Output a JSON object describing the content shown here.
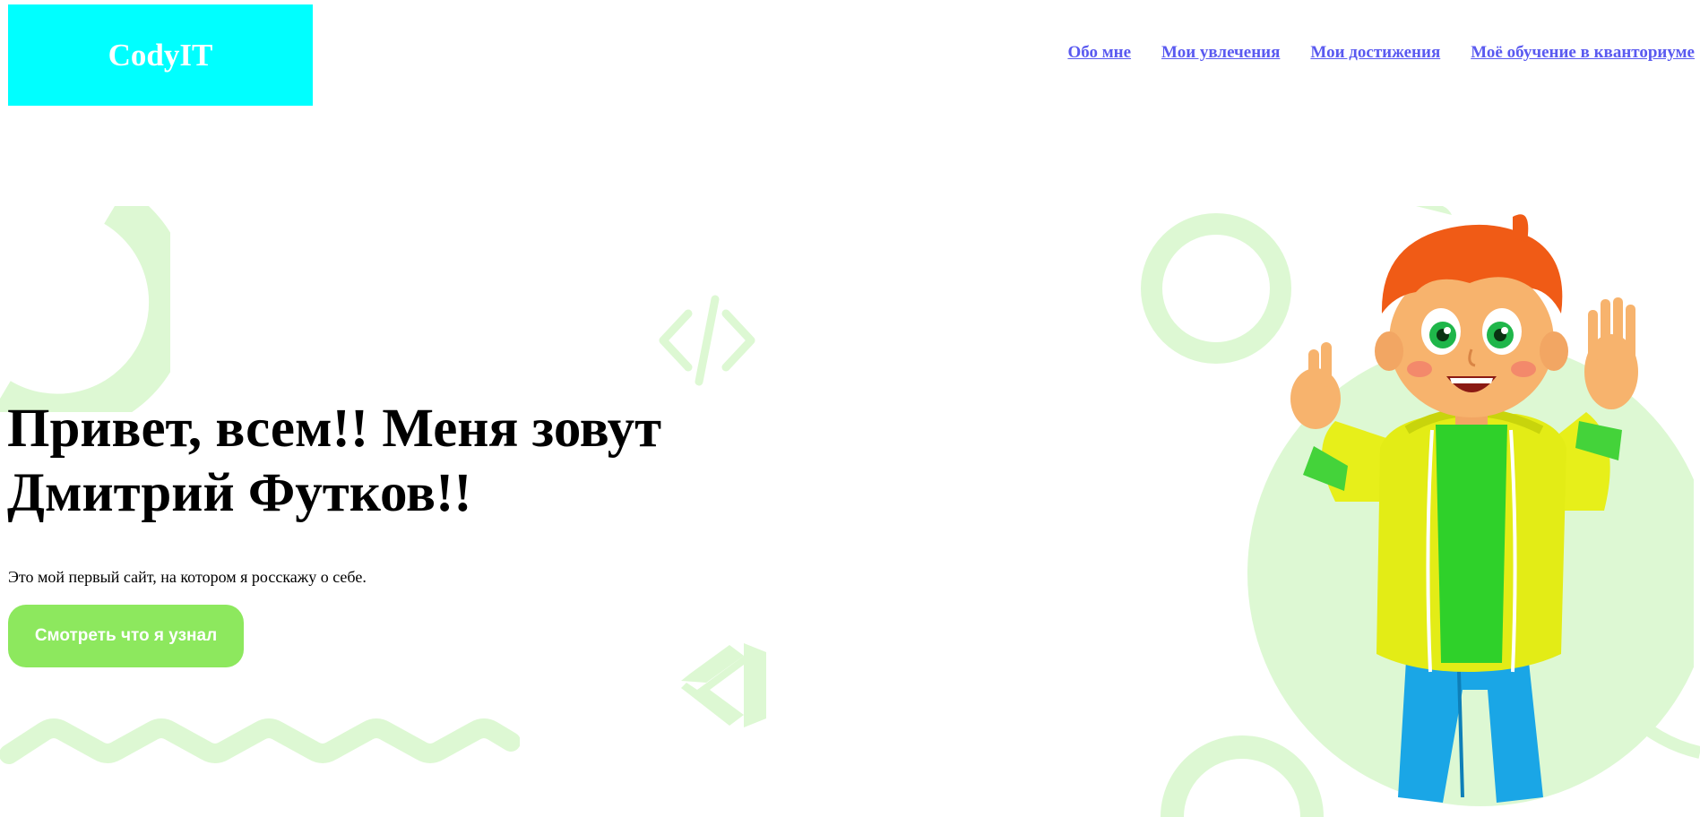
{
  "header": {
    "logo_text": "CodyIT",
    "nav": [
      {
        "label": "Обо мне"
      },
      {
        "label": "Мои увлечения"
      },
      {
        "label": "Мои достижения"
      },
      {
        "label": "Моё обучение в кванториуме"
      }
    ]
  },
  "hero": {
    "title_line1": "Привет, всем!! Меня зовут",
    "title_line2": "Дмитрий Футков!!",
    "subtitle": "Это мой первый сайт, на котором я росскажу о себе.",
    "cta_label": "Смотреть что я узнал"
  },
  "colors": {
    "logo_bg": "#00ffff",
    "nav_link": "#5a5af0",
    "cta_bg": "#8de85e",
    "decor": "#ddf8d3"
  },
  "icons": {
    "code_brackets": "code-brackets-icon",
    "vscode": "vscode-logo-icon",
    "boy": "boy-avatar-illustration"
  }
}
